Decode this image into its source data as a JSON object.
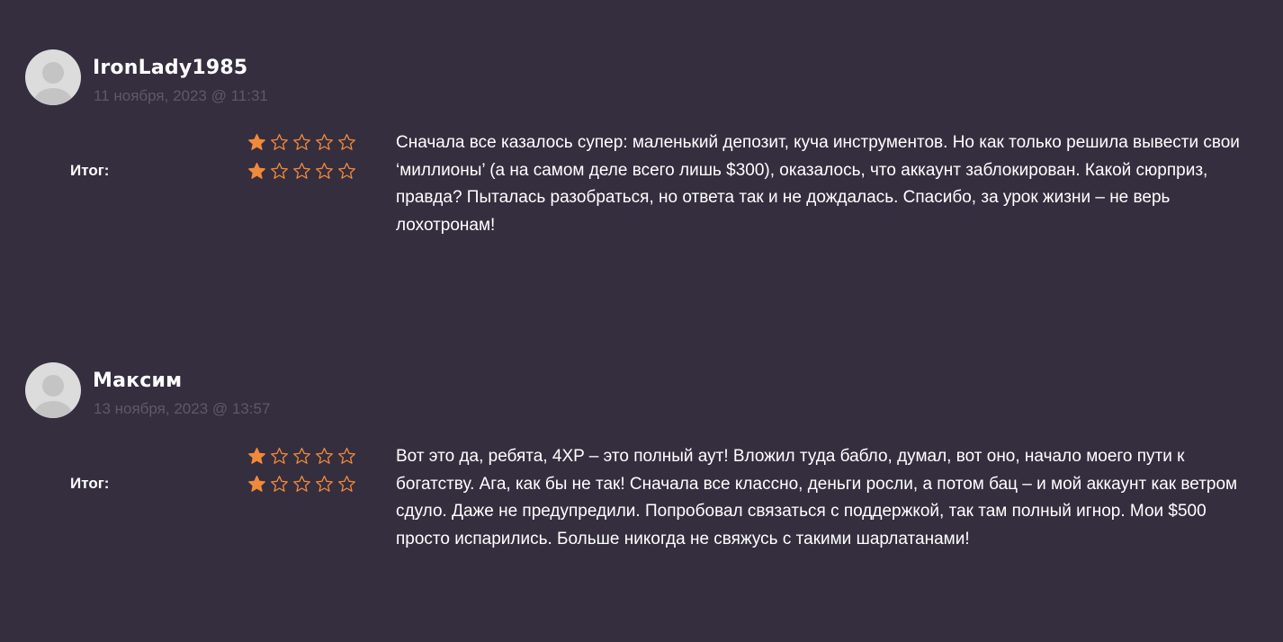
{
  "colors": {
    "background": "#352e3f",
    "star_filled": "#f08a3a",
    "star_empty_outline": "#f08a3a",
    "date_text": "#5f5868"
  },
  "reviews": [
    {
      "author": "IronLady1985",
      "date": "11 ноября, 2023 @ 11:31",
      "total_label": "Итог:",
      "ratings": [
        1,
        1
      ],
      "max_rating": 5,
      "text": "Сначала все казалось супер: маленький депозит, куча инструментов. Но как только решила вывести свои ‘миллионы’ (а на самом деле всего лишь $300), оказалось, что аккаунт заблокирован. Какой сюрприз, правда? Пыталась разобраться, но ответа так и не дождалась. Спасибо, за урок жизни – не верь лохотронам!"
    },
    {
      "author": "Максим",
      "date": "13 ноября, 2023 @ 13:57",
      "total_label": "Итог:",
      "ratings": [
        1,
        1
      ],
      "max_rating": 5,
      "text": "Вот это да, ребята, 4XP – это полный аут! Вложил туда бабло, думал, вот оно, начало моего пути к богатству. Ага, как бы не так! Сначала все классно, деньги росли, а потом бац – и мой аккаунт как ветром сдуло. Даже не предупредили. Попробовал связаться с поддержкой, так там полный игнор. Мои $500 просто испарились. Больше никогда не свяжусь с такими шарлатанами!"
    }
  ]
}
